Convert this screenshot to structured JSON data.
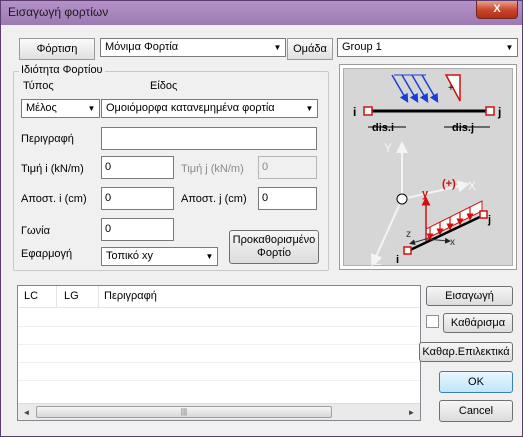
{
  "window": {
    "title": "Εισαγωγή φορτίων",
    "close_label": "X"
  },
  "load_tab": {
    "label": "Φόρτιση",
    "value": "Μόνιμα Φορτία"
  },
  "group": {
    "label": "Ομάδα",
    "value": "Group 1"
  },
  "properties": {
    "title": "Ιδιότητα Φορτίου",
    "type_label": "Τύπος",
    "kind_label": "Είδος",
    "type_value": "Μέλος",
    "kind_value": "Ομοιόμορφα κατανεμημένα φορτία",
    "description_label": "Περιγραφή",
    "description_value": "",
    "value_i_label": "Τιμή i (kN/m)",
    "value_i": "0",
    "value_j_label": "Τιμή j (kN/m)",
    "value_j": "0",
    "dist_i_label": "Αποστ. i (cm)",
    "dist_i": "0",
    "dist_j_label": "Αποστ. j (cm)",
    "dist_j": "0",
    "angle_label": "Γωνία",
    "angle": "0",
    "apply_label": "Εφαρμογή",
    "apply_value": "Τοπικό xy",
    "predefined_label_1": "Προκαθορισμένο",
    "predefined_label_2": "Φορτίο"
  },
  "diagram": {
    "i": "i",
    "j": "j",
    "dis_i": "dis.i",
    "dis_j": "dis.j",
    "Y": "Y",
    "X": "X",
    "Z": "Z",
    "y": "y",
    "x": "x",
    "z": "z",
    "plus": "(+)",
    "sign": "+",
    "i2": "i",
    "j2": "j"
  },
  "table": {
    "columns": [
      "LC",
      "LG",
      "Περιγραφή"
    ],
    "rows": []
  },
  "buttons": {
    "insert": "Εισαγωγή",
    "clear": "Καθάρισμα",
    "clear_selected": "Καθαρ.Επιλεκτικά",
    "ok": "OK",
    "cancel": "Cancel"
  },
  "scroll": {
    "left": "◄",
    "right": "►",
    "grip": "|||"
  }
}
